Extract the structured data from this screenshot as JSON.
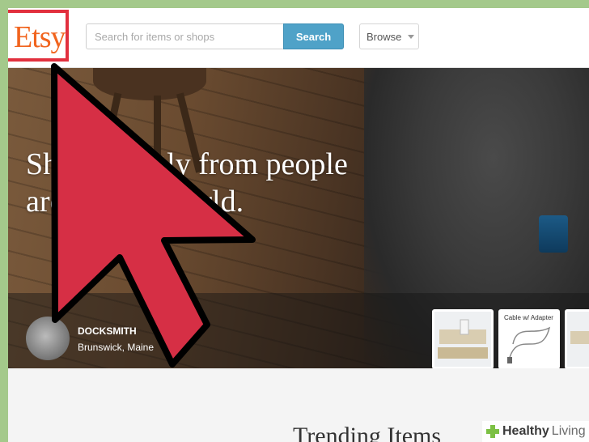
{
  "header": {
    "logo_text": "Etsy",
    "search_placeholder": "Search for items or shops",
    "search_button": "Search",
    "browse_label": "Browse"
  },
  "hero": {
    "headline_line1": "Shop directly from people",
    "headline_line2": "around the world.",
    "featured_shop": {
      "name": "DOCKSMITH",
      "location": "Brunswick, Maine"
    },
    "thumbnails": [
      {
        "caption": ""
      },
      {
        "caption": "Cable w/ Adapter"
      },
      {
        "caption": ""
      }
    ]
  },
  "section": {
    "title": "Trending Items"
  },
  "watermark": {
    "brand_bold": "Healthy",
    "brand_light": "Living"
  },
  "colors": {
    "logo": "#f1641e",
    "search_button": "#4fa2c8",
    "highlight": "#e2303e",
    "arrow": "#d62f45"
  }
}
